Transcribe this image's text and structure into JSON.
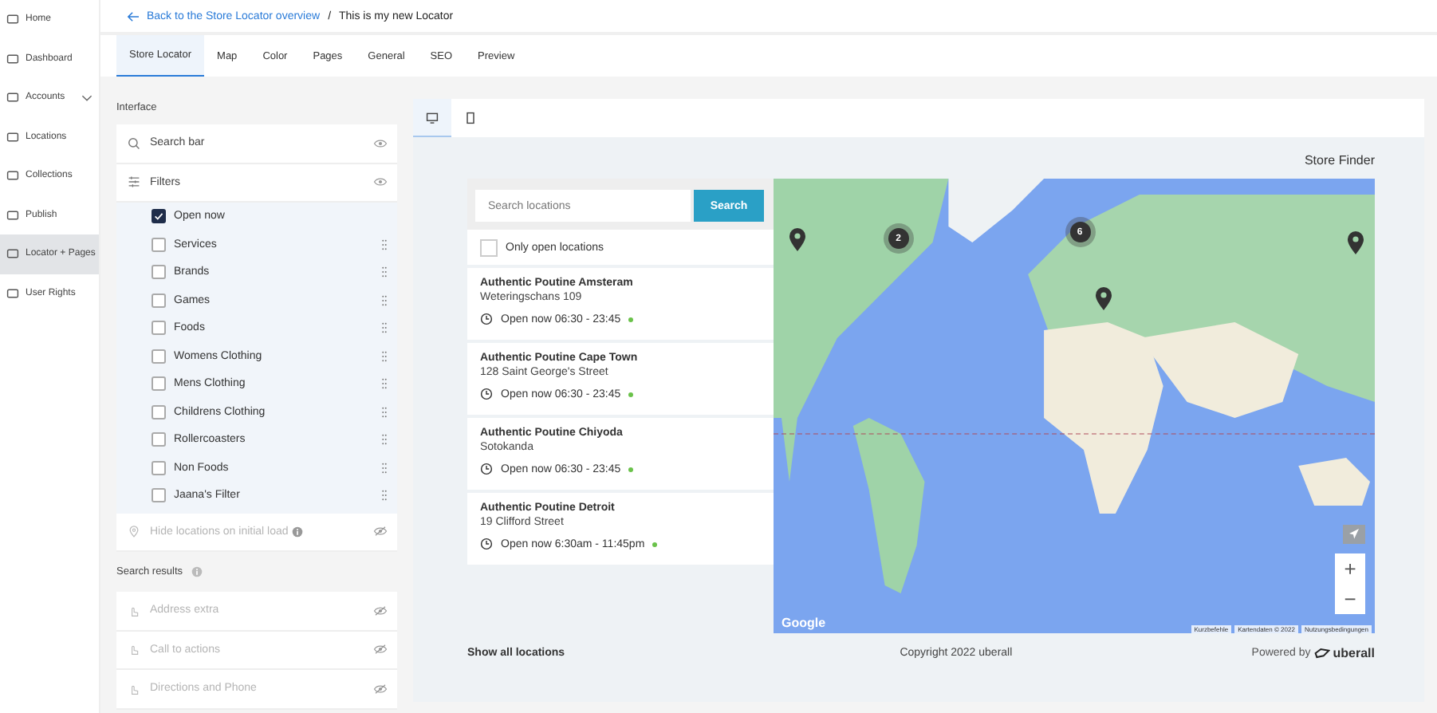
{
  "sidebar": {
    "items": [
      {
        "label": "Home",
        "kind": "link",
        "selected": false
      },
      {
        "label": "Dashboard",
        "kind": "link",
        "selected": false
      },
      {
        "label": "Accounts",
        "kind": "group",
        "selected": false
      },
      {
        "label": "Locations",
        "kind": "link",
        "selected": false
      },
      {
        "label": "Collections",
        "kind": "link",
        "selected": false
      },
      {
        "label": "Publish",
        "kind": "link",
        "selected": false
      },
      {
        "label": "Locator + Pages",
        "kind": "link",
        "selected": true
      },
      {
        "label": "User Rights",
        "kind": "link",
        "selected": false
      }
    ]
  },
  "breadcrumb": {
    "back_link": "Back to the Store Locator overview",
    "separator": "/",
    "current": "This is my new Locator"
  },
  "tabs": [
    {
      "label": "Store Locator",
      "selected": true
    },
    {
      "label": "Map",
      "selected": false
    },
    {
      "label": "Color",
      "selected": false
    },
    {
      "label": "Pages",
      "selected": false
    },
    {
      "label": "General",
      "selected": false
    },
    {
      "label": "SEO",
      "selected": false
    },
    {
      "label": "Preview",
      "selected": false
    }
  ],
  "interface": {
    "heading": "Interface",
    "search_bar": {
      "label": "Search bar",
      "visible": true
    },
    "filters": {
      "label": "Filters",
      "visible": true,
      "options": [
        {
          "label": "Open now",
          "checked": true,
          "draggable": false
        },
        {
          "label": "Services",
          "checked": false,
          "draggable": true
        },
        {
          "label": "Brands",
          "checked": false,
          "draggable": true
        },
        {
          "label": "Games",
          "checked": false,
          "draggable": true
        },
        {
          "label": "Foods",
          "checked": false,
          "draggable": true
        },
        {
          "label": "Womens Clothing",
          "checked": false,
          "draggable": true
        },
        {
          "label": "Mens Clothing",
          "checked": false,
          "draggable": true
        },
        {
          "label": "Childrens Clothing",
          "checked": false,
          "draggable": true
        },
        {
          "label": "Rollercoasters",
          "checked": false,
          "draggable": true
        },
        {
          "label": "Non Foods",
          "checked": false,
          "draggable": true
        },
        {
          "label": "Jaana's Filter",
          "checked": false,
          "draggable": true
        }
      ]
    },
    "hide_on_load": {
      "label": "Hide locations on initial load",
      "visible": false
    }
  },
  "search_results": {
    "heading": "Search results",
    "rows": [
      {
        "label": "Address extra",
        "visible": false
      },
      {
        "label": "Call to actions",
        "visible": false
      },
      {
        "label": "Directions and Phone",
        "visible": false
      }
    ]
  },
  "preview": {
    "device_tabs": [
      {
        "kind": "desktop",
        "selected": true
      },
      {
        "kind": "tablet",
        "selected": false
      }
    ],
    "title": "Store Finder",
    "search": {
      "placeholder": "Search locations",
      "button": "Search"
    },
    "only_open": {
      "label": "Only open locations",
      "checked": false
    },
    "locations": [
      {
        "name": "Authentic Poutine Amsteram",
        "address": "Weteringschans 109",
        "hours": "Open now 06:30 - 23:45",
        "open": true
      },
      {
        "name": "Authentic Poutine Cape Town",
        "address": "128 Saint George's Street",
        "hours": "Open now 06:30 - 23:45",
        "open": true
      },
      {
        "name": "Authentic Poutine Chiyoda",
        "address": "Sotokanda",
        "hours": "Open now 06:30 - 23:45",
        "open": true
      },
      {
        "name": "Authentic Poutine Detroit",
        "address": "19 Clifford Street",
        "hours": "Open now 6:30am - 11:45pm",
        "open": true
      }
    ],
    "map": {
      "markers": [
        {
          "kind": "pin"
        },
        {
          "kind": "cluster",
          "count": "2"
        },
        {
          "kind": "cluster",
          "count": "6"
        },
        {
          "kind": "pin"
        },
        {
          "kind": "pin"
        }
      ],
      "zoom_in": "+",
      "zoom_out": "−",
      "logo": "Google",
      "attribution": [
        "Kurzbefehle",
        "Kartendaten © 2022",
        "Nutzungsbedingungen"
      ]
    },
    "show_all": "Show all locations",
    "copyright": "Copyright 2022 uberall",
    "powered_by": "Powered by",
    "brand": "uberall"
  }
}
